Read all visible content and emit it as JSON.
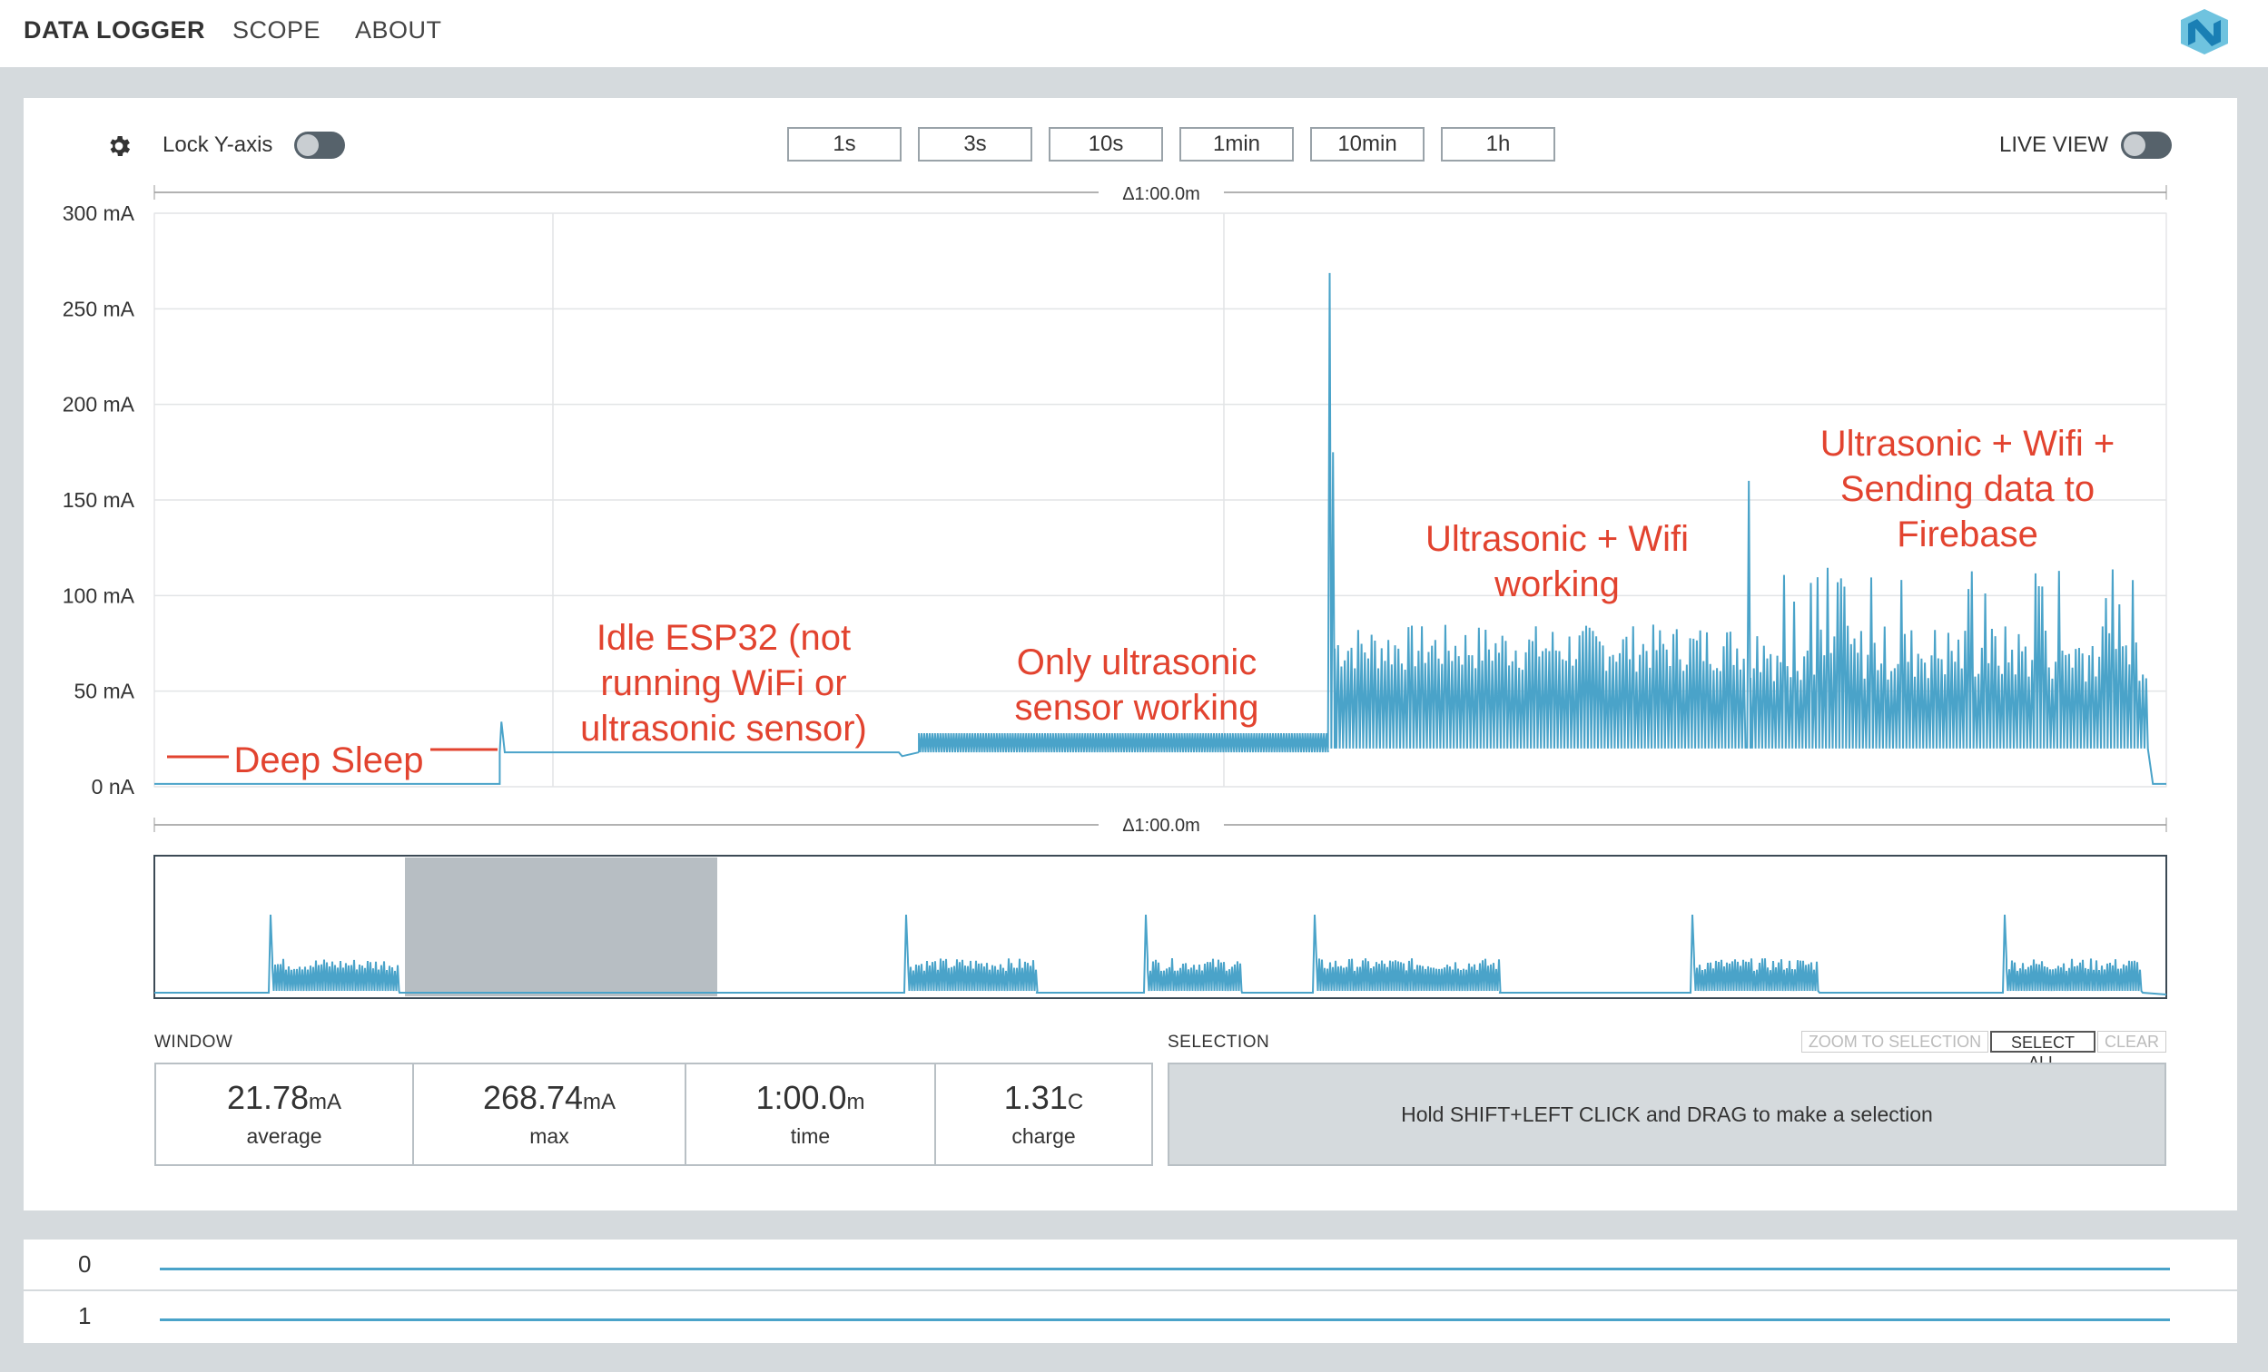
{
  "nav": {
    "items": [
      "DATA LOGGER",
      "SCOPE",
      "ABOUT"
    ]
  },
  "toolbar": {
    "lock_y_axis_label": "Lock Y-axis",
    "live_view_label": "LIVE VIEW",
    "time_buttons": [
      "1s",
      "3s",
      "10s",
      "1min",
      "10min",
      "1h"
    ]
  },
  "chart": {
    "window_delta_label": "Δ1:00.0m",
    "y_tick_labels": [
      "300 mA",
      "250 mA",
      "200 mA",
      "150 mA",
      "100 mA",
      "50 mA",
      "0 nA"
    ],
    "annotations": [
      "Deep Sleep",
      "Idle ESP32 (not",
      "running WiFi or",
      "ultrasonic sensor)",
      "Only ultrasonic",
      "sensor working",
      "Ultrasonic + Wifi",
      "working",
      "Ultrasonic + Wifi +",
      "Sending data to",
      "Firebase"
    ]
  },
  "chart_data": {
    "type": "line",
    "y_unit": "mA",
    "ylim": [
      0,
      300
    ],
    "x_span": "1:00.0m",
    "series": [
      {
        "segment": "Deep Sleep",
        "x_range_s": [
          0,
          10.3
        ],
        "baseline_mA": 1.5
      },
      {
        "segment": "Idle ESP32",
        "x_range_s": [
          10.3,
          22.8
        ],
        "baseline_mA": 18,
        "spike_mA": 34
      },
      {
        "segment": "Only ultrasonic sensor working",
        "x_range_s": [
          22.8,
          35
        ],
        "low_mA": 18,
        "high_mA": 28
      },
      {
        "segment": "Ultrasonic + Wifi working",
        "x_range_s": [
          35,
          47.5
        ],
        "low_mA": 20,
        "high_mA": 85,
        "spike_mA": 268.7
      },
      {
        "segment": "Ultrasonic + Wifi + Sending data to Firebase",
        "x_range_s": [
          47.5,
          59.5
        ],
        "low_mA": 20,
        "high_mA": 115,
        "spike_mA": 160
      },
      {
        "segment": "end",
        "x_range_s": [
          59.5,
          60
        ],
        "baseline_mA": 1.5
      }
    ],
    "grid": true
  },
  "window": {
    "label": "WINDOW",
    "stats": [
      {
        "value": "21.78",
        "unit": "mA",
        "label": "average"
      },
      {
        "value": "268.74",
        "unit": "mA",
        "label": "max"
      },
      {
        "value": "1:00.0",
        "unit": "m",
        "label": "time"
      },
      {
        "value": "1.31",
        "unit": "C",
        "label": "charge"
      }
    ]
  },
  "selection": {
    "label": "SELECTION",
    "buttons": [
      "ZOOM TO SELECTION",
      "SELECT ALL",
      "CLEAR"
    ],
    "hint": "Hold SHIFT+LEFT CLICK and DRAG to make a selection"
  },
  "digital_channels": [
    "0",
    "1"
  ],
  "colors": {
    "trace": "#4aa3c9",
    "annotation": "#e2432f",
    "panel_bg": "#d5dadd"
  }
}
